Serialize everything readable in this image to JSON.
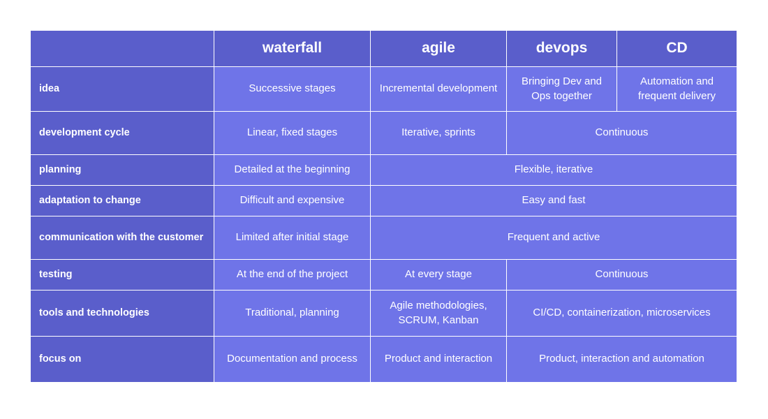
{
  "table": {
    "columns": [
      {
        "key": "label",
        "label": ""
      },
      {
        "key": "waterfall",
        "label": "waterfall"
      },
      {
        "key": "agile",
        "label": "agile"
      },
      {
        "key": "devops",
        "label": "devops"
      },
      {
        "key": "cd",
        "label": "CD"
      }
    ],
    "rows": [
      {
        "label": "idea",
        "cells": [
          {
            "text": "Successive stages",
            "span": 1
          },
          {
            "text": "Incremental development",
            "span": 1
          },
          {
            "text": "Bringing Dev and Ops together",
            "span": 1
          },
          {
            "text": "Automation and frequent delivery",
            "span": 1
          }
        ]
      },
      {
        "label": "development cycle",
        "cells": [
          {
            "text": "Linear, fixed stages",
            "span": 1
          },
          {
            "text": "Iterative, sprints",
            "span": 1
          },
          {
            "text": "Continuous",
            "span": 2
          }
        ]
      },
      {
        "label": "planning",
        "cells": [
          {
            "text": "Detailed at the beginning",
            "span": 1
          },
          {
            "text": "Flexible, iterative",
            "span": 3
          }
        ]
      },
      {
        "label": "adaptation to change",
        "cells": [
          {
            "text": "Difficult and expensive",
            "span": 1
          },
          {
            "text": "Easy and fast",
            "span": 3
          }
        ]
      },
      {
        "label": "communication with the customer",
        "cells": [
          {
            "text": "Limited after initial stage",
            "span": 1
          },
          {
            "text": "Frequent and active",
            "span": 3
          }
        ]
      },
      {
        "label": "testing",
        "cells": [
          {
            "text": "At the end of the project",
            "span": 1
          },
          {
            "text": "At every stage",
            "span": 1
          },
          {
            "text": "Continuous",
            "span": 2
          }
        ]
      },
      {
        "label": "tools and technologies",
        "cells": [
          {
            "text": "Traditional, planning",
            "span": 1
          },
          {
            "text": "Agile methodologies, SCRUM, Kanban",
            "span": 1
          },
          {
            "text": "CI/CD, containerization, microservices",
            "span": 2
          }
        ]
      },
      {
        "label": "focus on",
        "cells": [
          {
            "text": "Documentation and process",
            "span": 1
          },
          {
            "text": "Product and interaction",
            "span": 1
          },
          {
            "text": "Product, interaction and automation",
            "span": 2
          }
        ]
      }
    ]
  },
  "colors": {
    "header_bg": "#5a5ecb",
    "cell_bg": "#6f74e8",
    "text": "#ffffff",
    "page_bg": "#ffffff",
    "border": "#ffffff"
  }
}
